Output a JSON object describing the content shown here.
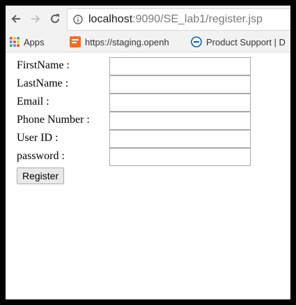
{
  "browser": {
    "url_host": "localhost",
    "url_path": ":9090/SE_lab1/register.jsp",
    "icons": {
      "back": "arrow-left-icon",
      "forward": "arrow-right-icon",
      "reload": "reload-icon",
      "site_info": "info-icon"
    }
  },
  "bookmarks": [
    {
      "label": "Apps",
      "icon": "apps-grid-icon"
    },
    {
      "label": "https://staging.openh",
      "icon": "site-favicon-icon"
    },
    {
      "label": "Product Support | D",
      "icon": "support-favicon-icon"
    }
  ],
  "form": {
    "fields": [
      {
        "label": "FirstName :",
        "value": ""
      },
      {
        "label": "LastName :",
        "value": ""
      },
      {
        "label": "Email :",
        "value": ""
      },
      {
        "label": "Phone Number :",
        "value": ""
      },
      {
        "label": "User ID :",
        "value": ""
      },
      {
        "label": "password :",
        "value": ""
      }
    ],
    "submit_label": "Register"
  },
  "colors": {
    "page_background": "#ffffff",
    "outer_frame": "#000000",
    "toolbar_background": "#f2f2f2",
    "apps_grid_colors": [
      "#ea4335",
      "#fbbc05",
      "#34a853",
      "#4285f4"
    ],
    "staging_favicon": "#e8702a",
    "support_favicon": "#0a5fa8"
  }
}
